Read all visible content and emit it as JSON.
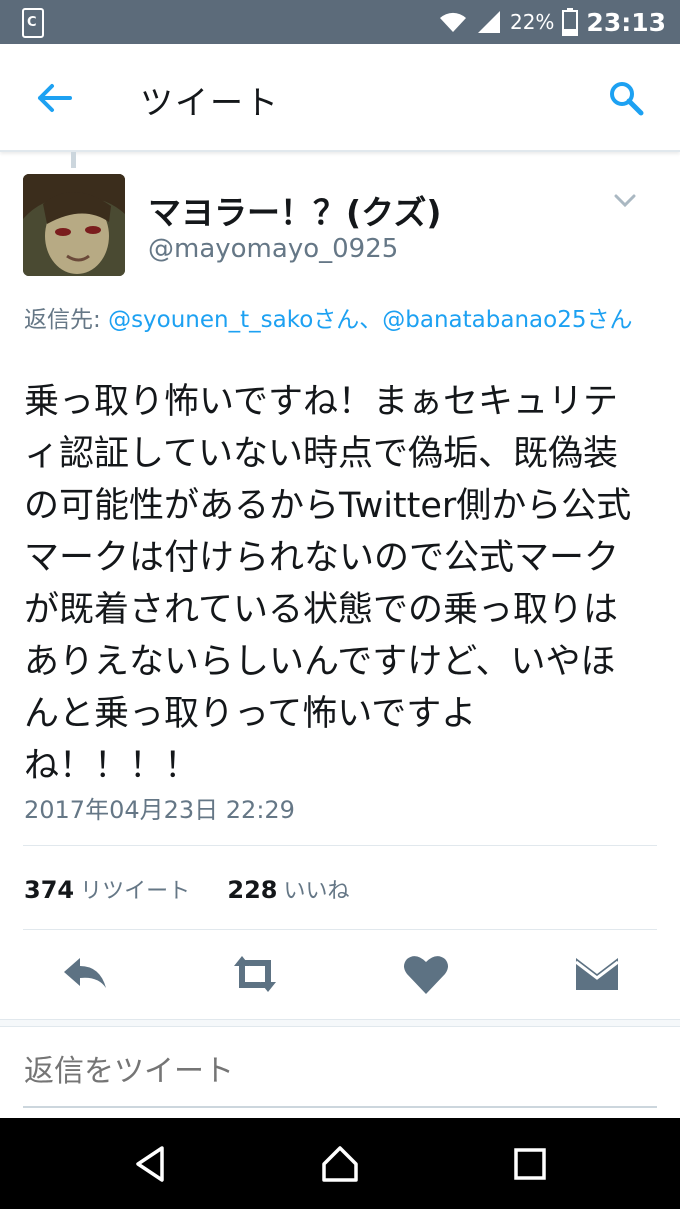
{
  "status_bar": {
    "battery_percent": "22%",
    "time": "23:13",
    "notification_icon": "clipboard-icon"
  },
  "app_bar": {
    "title": "ツイート",
    "back_icon": "arrow-left-icon",
    "search_icon": "search-icon"
  },
  "tweet": {
    "display_name": "マヨラー！？(クズ)",
    "screen_name": "@mayomayo_0925",
    "reply_prefix": "返信先: ",
    "reply_link_1": "@syounen_t_sakoさん",
    "reply_separator": "、",
    "reply_link_2": "@banatabanao25さん",
    "text": "乗っ取り怖いですね！まぁセキュリティ認証していない時点で偽垢、既偽装の可能性があるからTwitter側から公式マークは付けられないので公式マークが既着されている状態での乗っ取りはありえないらしいんですけど、いやほんと乗っ取りって怖いですよね！！！！",
    "timestamp": "2017年04月23日 22:29"
  },
  "stats": {
    "retweet_count": "374",
    "retweet_label": "リツイート",
    "like_count": "228",
    "like_label": "いいね"
  },
  "actions": [
    "reply-icon",
    "retweet-icon",
    "heart-icon",
    "message-icon"
  ],
  "reply_box": {
    "placeholder": "返信をツイート"
  },
  "nav_bar": [
    "back-triangle-icon",
    "home-icon",
    "recents-icon"
  ],
  "colors": {
    "accent": "#1da1f2",
    "status_bar": "#5c6b7a",
    "secondary_text": "#657786",
    "action_icon": "#5d7283"
  }
}
